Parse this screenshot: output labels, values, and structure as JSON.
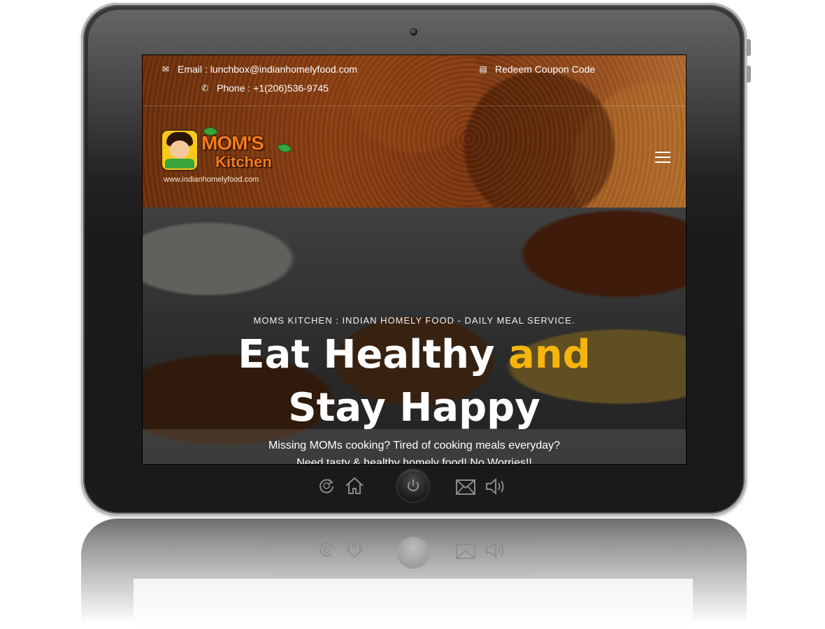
{
  "topbar": {
    "email": "Email : lunchbox@indianhomelyfood.com",
    "phone": "Phone : +1(206)536-9745",
    "coupon": "Redeem Coupon Code"
  },
  "logo": {
    "line1": "MOM'S",
    "line2": "Kitchen",
    "url": "www.indianhomelyfood.com"
  },
  "hero": {
    "subtitle": "MOMS KITCHEN : INDIAN HOMELY FOOD - DAILY MEAL SERVICE.",
    "title_part1": "Eat Healthy ",
    "title_accent": "and",
    "title_line2": "Stay Happy",
    "desc_line1": "Missing MOMs cooking? Tired of cooking meals everyday?",
    "desc_line2": "Need tasty & healthy homely food! No Worries!!"
  },
  "colors": {
    "accent": "#f5b50d",
    "header_brown": "#8a3e12",
    "logo_orange": "#f47a1a"
  },
  "icons": [
    "envelope-icon",
    "phone-icon",
    "coupon-icon",
    "menu-icon",
    "refresh-icon",
    "home-icon",
    "power-icon",
    "mail-icon",
    "speaker-icon"
  ]
}
